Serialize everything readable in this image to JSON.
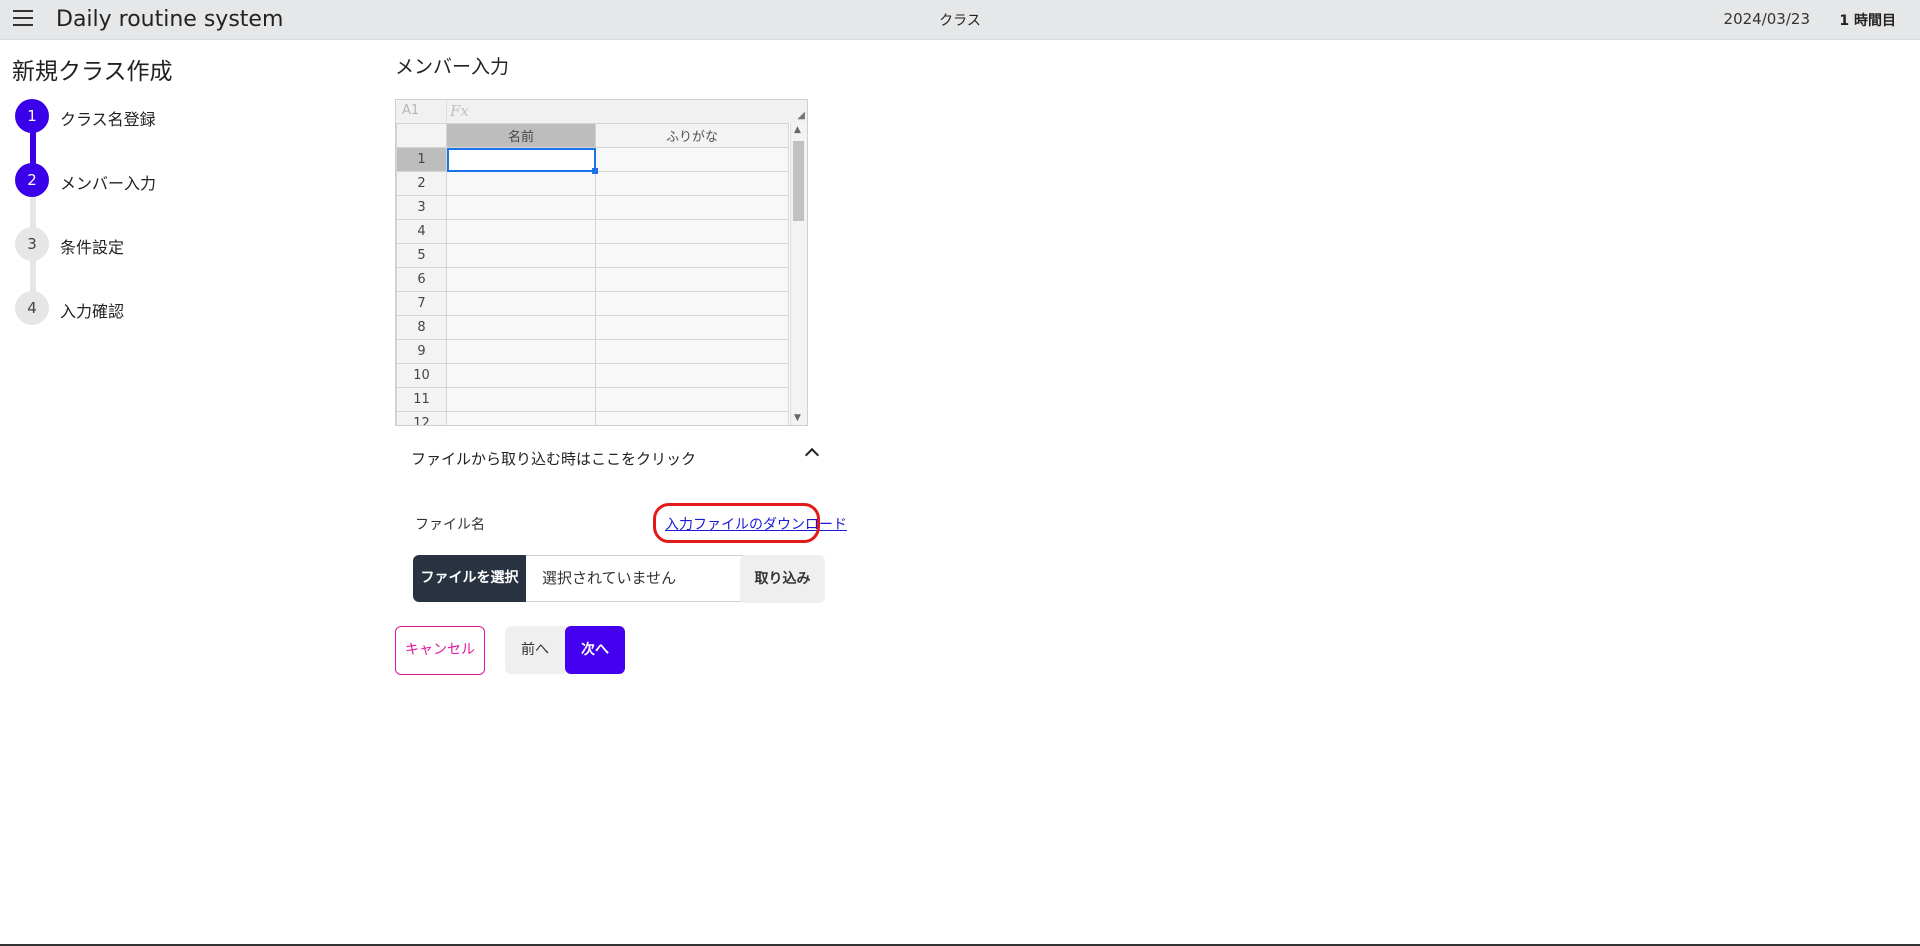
{
  "header": {
    "app_title": "Daily routine system",
    "center_title": "クラス",
    "date": "2024/03/23",
    "period": "1 時間目",
    "menu_icon": "hamburger-menu-icon"
  },
  "page_title": "新規クラス作成",
  "stepper": {
    "steps": [
      {
        "number": "1",
        "label": "クラス名登録",
        "active": true
      },
      {
        "number": "2",
        "label": "メンバー入力",
        "active": true
      },
      {
        "number": "3",
        "label": "条件設定",
        "active": false
      },
      {
        "number": "4",
        "label": "入力確認",
        "active": false
      }
    ],
    "active_color": "#3b00ea"
  },
  "section_title": "メンバー入力",
  "spreadsheet": {
    "cell_ref": "A1",
    "fx_label": "Fx",
    "columns": [
      "名前",
      "ふりがな"
    ],
    "rows": [
      "1",
      "2",
      "3",
      "4",
      "5",
      "6",
      "7",
      "8",
      "9",
      "10",
      "11",
      "12"
    ],
    "selected_cell": "A1"
  },
  "import": {
    "toggle_text": "ファイルから取り込む時はここをクリック",
    "file_label": "ファイル名",
    "download_link": "入力ファイルのダウンロード",
    "choose_button": "ファイルを選択",
    "no_file_text": "選択されていません",
    "import_button": "取り込み"
  },
  "actions": {
    "cancel": "キャンセル",
    "prev": "前へ",
    "next": "次へ"
  },
  "colors": {
    "primary": "#4600f0",
    "cancel": "#e0179d",
    "highlight": "#e21a1a",
    "dark_button": "#283241"
  }
}
